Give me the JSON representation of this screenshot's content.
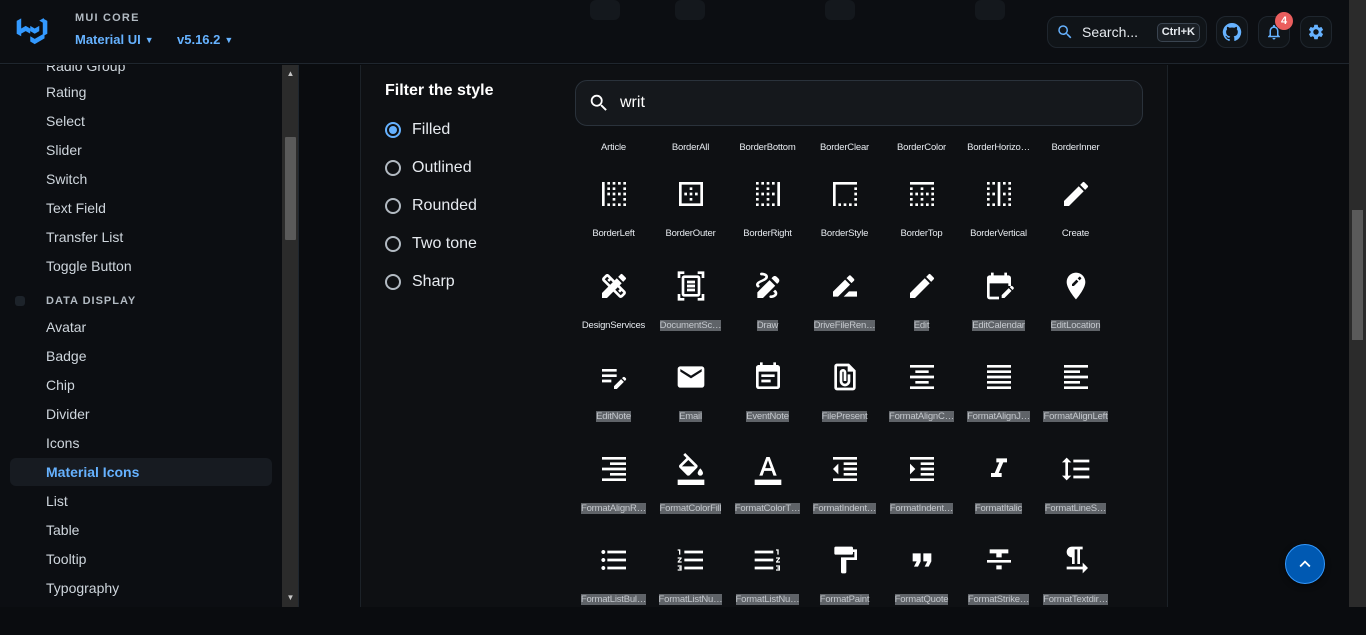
{
  "header": {
    "brand_label": "MUI CORE",
    "product": "Material UI",
    "version": "v5.16.2",
    "search_label": "Search...",
    "search_shortcut": "Ctrl+K",
    "notifications_count": "4",
    "icons": [
      "mui-logo-icon",
      "search-icon",
      "github-icon",
      "bell-icon",
      "gear-icon"
    ]
  },
  "sidebar": {
    "items": [
      {
        "label": "Radio Group"
      },
      {
        "label": "Rating"
      },
      {
        "label": "Select"
      },
      {
        "label": "Slider"
      },
      {
        "label": "Switch"
      },
      {
        "label": "Text Field"
      },
      {
        "label": "Transfer List"
      },
      {
        "label": "Toggle Button"
      }
    ],
    "section_title": "DATA DISPLAY",
    "section_items": [
      {
        "label": "Avatar"
      },
      {
        "label": "Badge"
      },
      {
        "label": "Chip"
      },
      {
        "label": "Divider"
      },
      {
        "label": "Icons"
      },
      {
        "label": "Material Icons",
        "active": true
      },
      {
        "label": "List"
      },
      {
        "label": "Table"
      },
      {
        "label": "Tooltip"
      },
      {
        "label": "Typography"
      }
    ]
  },
  "filter": {
    "title": "Filter the style",
    "options": [
      {
        "label": "Filled",
        "checked": true
      },
      {
        "label": "Outlined",
        "checked": false
      },
      {
        "label": "Rounded",
        "checked": false
      },
      {
        "label": "Two tone",
        "checked": false
      },
      {
        "label": "Sharp",
        "checked": false
      }
    ]
  },
  "icon_search": {
    "value": "writ"
  },
  "icon_grid": {
    "top_row_names": [
      "Article",
      "BorderAll",
      "BorderBottom",
      "BorderClear",
      "BorderColor",
      "BorderHorizo…",
      "BorderInner"
    ],
    "rows": [
      [
        {
          "icon": "border-left-icon",
          "name": "BorderLeft"
        },
        {
          "icon": "border-outer-icon",
          "name": "BorderOuter"
        },
        {
          "icon": "border-right-icon",
          "name": "BorderRight"
        },
        {
          "icon": "border-style-icon",
          "name": "BorderStyle"
        },
        {
          "icon": "border-top-icon",
          "name": "BorderTop"
        },
        {
          "icon": "border-vertical-icon",
          "name": "BorderVertical"
        },
        {
          "icon": "create-icon",
          "name": "Create"
        }
      ],
      [
        {
          "icon": "design-services-icon",
          "name": "DesignServices"
        },
        {
          "icon": "document-scanner-icon",
          "name": "DocumentSc…",
          "sel": true
        },
        {
          "icon": "draw-icon",
          "name": "Draw",
          "sel": true
        },
        {
          "icon": "drive-file-rename-icon",
          "name": "DriveFileRen…",
          "sel": true
        },
        {
          "icon": "edit-icon",
          "name": "Edit",
          "sel": true
        },
        {
          "icon": "edit-calendar-icon",
          "name": "EditCalendar",
          "sel": true
        },
        {
          "icon": "edit-location-icon",
          "name": "EditLocation",
          "sel": true
        }
      ],
      [
        {
          "icon": "edit-note-icon",
          "name": "EditNote",
          "sel": true
        },
        {
          "icon": "email-icon",
          "name": "Email",
          "sel": true
        },
        {
          "icon": "event-note-icon",
          "name": "EventNote",
          "sel": true
        },
        {
          "icon": "file-present-icon",
          "name": "FilePresent",
          "sel": true
        },
        {
          "icon": "format-align-center-icon",
          "name": "FormatAlignC…",
          "sel": true
        },
        {
          "icon": "format-align-justify-icon",
          "name": "FormatAlignJ…",
          "sel": true
        },
        {
          "icon": "format-align-left-icon",
          "name": "FormatAlignLeft",
          "sel": true
        }
      ],
      [
        {
          "icon": "format-align-right-icon",
          "name": "FormatAlignR…",
          "sel": true
        },
        {
          "icon": "format-color-fill-icon",
          "name": "FormatColorFill",
          "sel": true
        },
        {
          "icon": "format-color-text-icon",
          "name": "FormatColorT…",
          "sel": true
        },
        {
          "icon": "format-indent-decrease-icon",
          "name": "FormatIndent…",
          "sel": true
        },
        {
          "icon": "format-indent-increase-icon",
          "name": "FormatIndent…",
          "sel": true
        },
        {
          "icon": "format-italic-icon",
          "name": "FormatItalic",
          "sel": true
        },
        {
          "icon": "format-line-spacing-icon",
          "name": "FormatLineS…",
          "sel": true
        }
      ],
      [
        {
          "icon": "format-list-bulleted-icon",
          "name": "FormatListBul…",
          "sel": true
        },
        {
          "icon": "format-list-numbered-icon",
          "name": "FormatListNu…",
          "sel": true
        },
        {
          "icon": "format-list-numbered-rtl-icon",
          "name": "FormatListNu…",
          "sel": true
        },
        {
          "icon": "format-paint-icon",
          "name": "FormatPaint",
          "sel": true
        },
        {
          "icon": "format-quote-icon",
          "name": "FormatQuote",
          "sel": true
        },
        {
          "icon": "format-strikethrough-icon",
          "name": "FormatStrike…",
          "sel": true
        },
        {
          "icon": "format-textdirection-icon",
          "name": "FormatTextdir…",
          "sel": true
        }
      ]
    ]
  },
  "colors": {
    "accent": "#66b2ff",
    "background": "#0a0c0f",
    "panel": "#0e1013",
    "badge": "#eb5e5e",
    "fab": "#0059b2"
  }
}
